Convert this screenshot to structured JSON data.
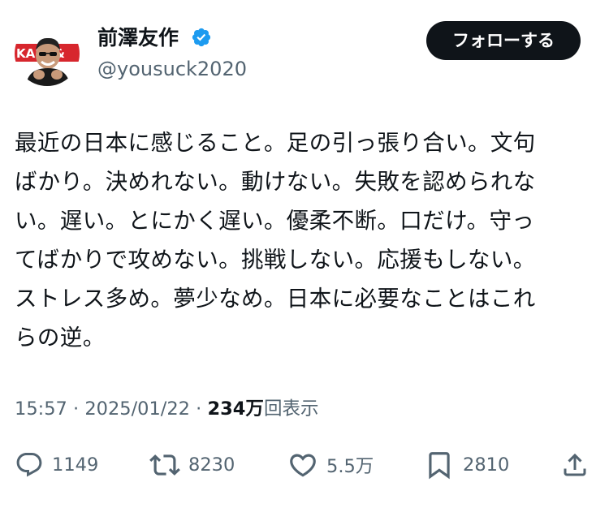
{
  "profile": {
    "display_name": "前澤友作",
    "handle": "@yousuck2020",
    "verified_icon": "verified-badge-icon",
    "avatar_banner_text": "KABU&"
  },
  "follow_button": {
    "label": "フォローする"
  },
  "tweet": {
    "text": "最近の日本に感じること。足の引っ張り合い。文句ばかり。決めれない。動けない。失敗を認められない。遅い。とにかく遅い。優柔不断。口だけ。守ってばかりで攻めない。挑戦しない。応援もしない。ストレス多め。夢少なめ。日本に必要なことはこれらの逆。",
    "lines": [
      "最近の日本に感じること。足の引っ張り合い。文句",
      "ばかり。決めれない。動けない。失敗を認められな",
      "い。遅い。とにかく遅い。優柔不断。口だけ。守っ",
      "てばかりで攻めない。挑戦しない。応援もしない。",
      "ストレス多め。夢少なめ。日本に必要なことはこれ",
      "らの逆。"
    ]
  },
  "meta": {
    "time": "15:57",
    "separator1": " · ",
    "date": "2025/01/22",
    "separator2": " · ",
    "views_count": "234万",
    "views_label": "回表示"
  },
  "actions": {
    "reply": {
      "icon": "reply-icon",
      "count": "1149"
    },
    "retweet": {
      "icon": "retweet-icon",
      "count": "8230"
    },
    "like": {
      "icon": "heart-icon",
      "count": "5.5万"
    },
    "bookmark": {
      "icon": "bookmark-icon",
      "count": "2810"
    },
    "share": {
      "icon": "share-icon"
    }
  },
  "colors": {
    "text_primary": "#0f1419",
    "text_secondary": "#536471",
    "verified_blue": "#1d9bf0",
    "button_bg": "#0f1419",
    "button_text": "#ffffff",
    "avatar_banner_red": "#d7262d"
  }
}
